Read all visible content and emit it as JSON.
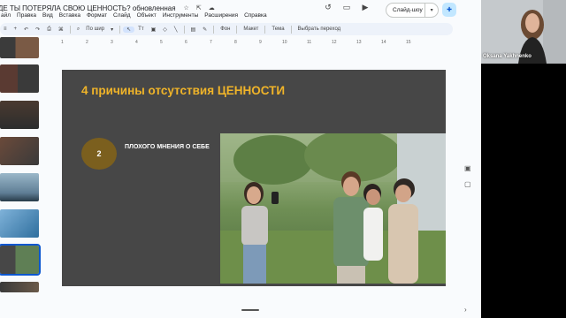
{
  "doc": {
    "title": "ДЕ ТЫ ПОТЕРЯЛА СВОЮ ЦЕННОСТЬ? обновленная",
    "title_icons": [
      "star-icon",
      "move-icon",
      "cloud-icon"
    ]
  },
  "menu": [
    "айл",
    "Правка",
    "Вид",
    "Вставка",
    "Формат",
    "Слайд",
    "Объект",
    "Инструменты",
    "Расширения",
    "Справка"
  ],
  "header_controls": {
    "slideshow_label": "Слайд-шоу",
    "slideshow_chevron": "▾"
  },
  "toolbar": {
    "zoom_label": "По шир",
    "bg_label": "Фон",
    "layout_label": "Макет",
    "theme_label": "Тема",
    "transition_label": "Выбрать переход"
  },
  "ruler": [
    "1",
    "2",
    "3",
    "4",
    "5",
    "6",
    "7",
    "8",
    "9",
    "10",
    "11",
    "12",
    "13",
    "14",
    "15"
  ],
  "slide": {
    "title": "4 причины отсутствия ЦЕННОСТИ",
    "number": "2",
    "point_text": "ПЛОХОГО МНЕНИЯ О СЕБЕ"
  },
  "video": {
    "participant_name": "Oksana Yakhnenko"
  },
  "colors": {
    "slide_bg": "#474747",
    "title_accent": "#f0b429",
    "circle": "#7b5f1e",
    "selection": "#0b57d0"
  }
}
